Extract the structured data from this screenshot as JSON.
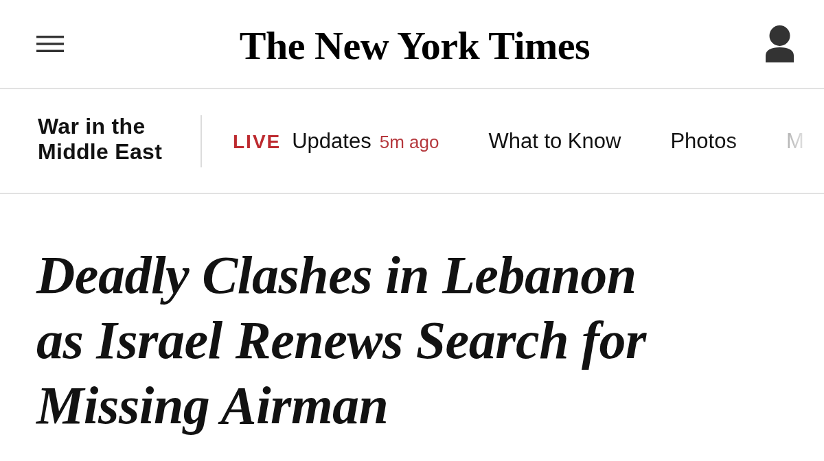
{
  "masthead": {
    "logo": "The New York Times"
  },
  "section_nav": {
    "section_title": "War in the Middle East",
    "items": [
      {
        "kind": "live",
        "badge": "LIVE",
        "label": "Updates",
        "timestamp": "5m ago"
      },
      {
        "kind": "link",
        "label": "What to Know"
      },
      {
        "kind": "link",
        "label": "Photos"
      },
      {
        "kind": "link",
        "label": "M"
      }
    ]
  },
  "article": {
    "headline": "Deadly Clashes in Lebanon as Israel Renews Search for Missing Airman"
  }
}
